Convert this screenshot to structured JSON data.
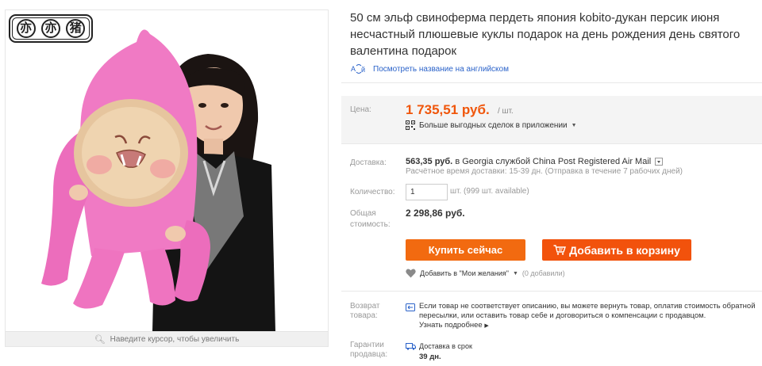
{
  "gallery": {
    "logo_glyphs": [
      "亦",
      "亦",
      "猪"
    ],
    "zoom_hint": "Наведите курсор, чтобы увеличить"
  },
  "product": {
    "title": "50 см эльф свиноферма пердеть япония kobito-дукан персик июня несчастный плюшевые куклы подарок на день рождения день святого валентина подарок",
    "translate_link": "Посмотреть название на английском"
  },
  "price": {
    "label": "Цена:",
    "value": "1 735,51 руб.",
    "unit": "/ шт.",
    "app_deals": "Больше выгодных сделок в приложении"
  },
  "shipping": {
    "label": "Доставка:",
    "cost": "563,35 руб.",
    "destination_text": "в Georgia службой China Post Registered Air Mail",
    "estimate": "Расчётное время доставки: 15-39 дн. (Отправка в течение 7 рабочих дней)"
  },
  "quantity": {
    "label": "Количество:",
    "value": "1",
    "available": "шт. (999 шт. available)"
  },
  "total": {
    "label": "Общая стоимость:",
    "value": "2 298,86 руб."
  },
  "actions": {
    "buy_now": "Купить сейчас",
    "add_to_cart": "Добавить в корзину",
    "wishlist": "Добавить в \"Мои желания\"",
    "wishlist_count": "(0 добавили)"
  },
  "returns": {
    "label": "Возврат товара:",
    "text": "Если товар не соответствует описанию, вы можете вернуть товар, оплатив стоимость обратной пересылки, или оставить товар себе и договориться о компенсации с продавцом.",
    "learn_more": "Узнать подробнее"
  },
  "guarantees": {
    "label": "Гарантии продавца:",
    "delivery_ontime": "Доставка в срок",
    "delivery_days": "39 дн."
  },
  "colors": {
    "accent_orange": "#f0560b",
    "buy_button": "#f26a10",
    "cart_button": "#f2520c",
    "link_blue": "#2a62c9",
    "plush_pink": "#f07ac4"
  }
}
